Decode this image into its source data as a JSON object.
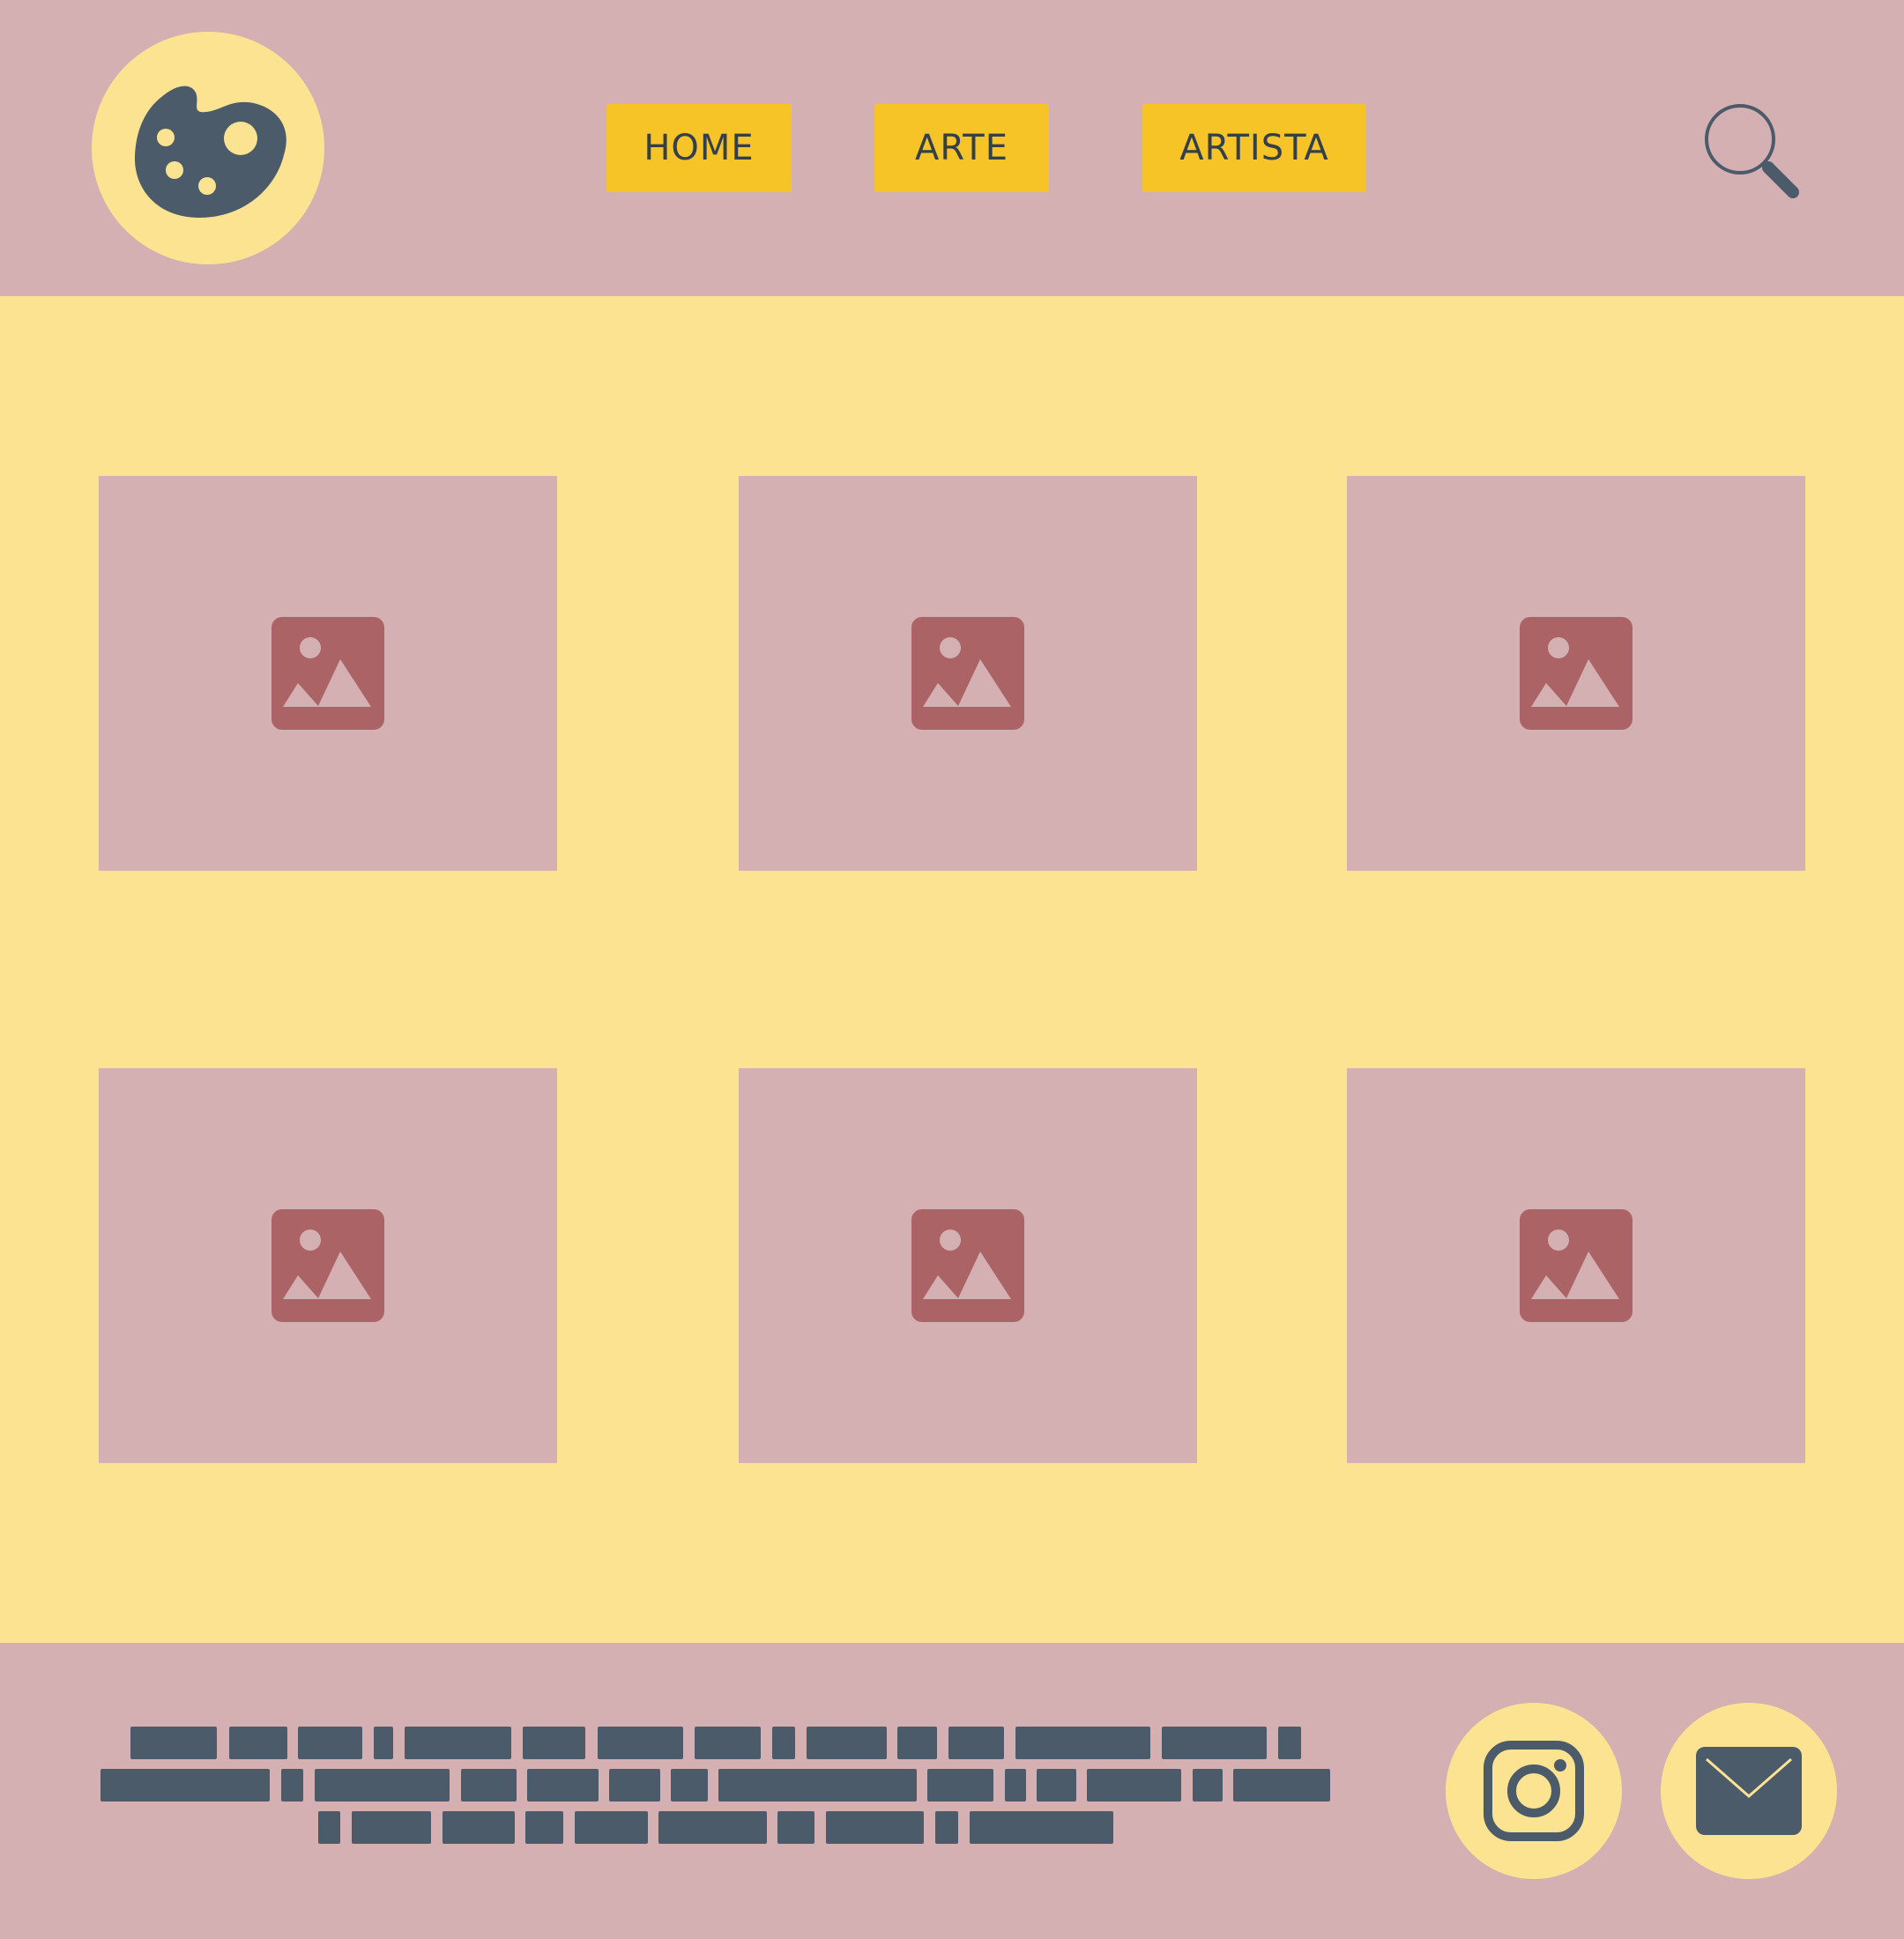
{
  "header": {
    "logo_icon": "palette-icon",
    "nav": [
      {
        "label": "HOME"
      },
      {
        "label": "ARTE"
      },
      {
        "label": "ARTISTA"
      }
    ],
    "search_icon": "search-icon"
  },
  "gallery": {
    "items": [
      {
        "icon": "image-placeholder-icon"
      },
      {
        "icon": "image-placeholder-icon"
      },
      {
        "icon": "image-placeholder-icon"
      },
      {
        "icon": "image-placeholder-icon"
      },
      {
        "icon": "image-placeholder-icon"
      },
      {
        "icon": "image-placeholder-icon"
      }
    ]
  },
  "footer": {
    "social": [
      {
        "icon": "instagram-icon"
      },
      {
        "icon": "mail-icon"
      }
    ]
  },
  "colors": {
    "header_bg": "#D4B0B2",
    "page_bg": "#FBE392",
    "nav_button": "#F6C427",
    "text_dark": "#33404C",
    "icon_dark": "#4B5B6A",
    "image_icon": "#AB6365"
  }
}
